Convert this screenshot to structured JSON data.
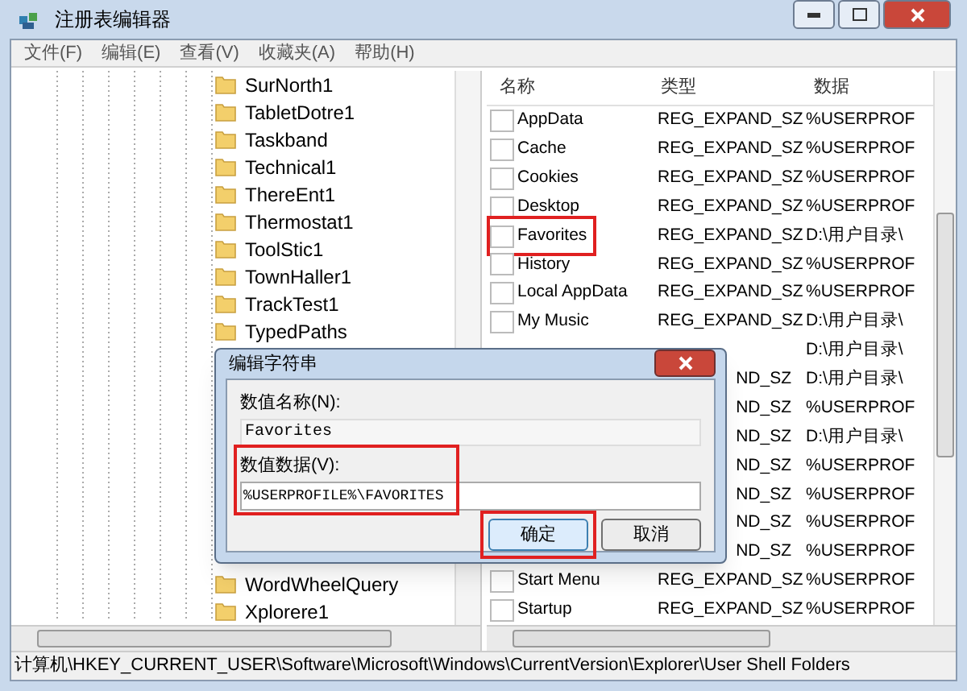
{
  "window": {
    "title": "注册表编辑器"
  },
  "menu": [
    "文件(F)",
    "编辑(E)",
    "查看(V)",
    "收藏夹(A)",
    "帮助(H)"
  ],
  "tree": {
    "items_top": [
      {
        "label": "SurNorth1"
      },
      {
        "label": "TabletDotre1"
      },
      {
        "label": "Taskband"
      },
      {
        "label": "Technical1"
      },
      {
        "label": "ThereEnt1"
      },
      {
        "label": "Thermostat1"
      },
      {
        "label": "ToolStic1"
      },
      {
        "label": "TownHaller1"
      },
      {
        "label": "TrackTest1"
      },
      {
        "label": "TypedPaths"
      }
    ],
    "items_bottom": [
      {
        "label": "WordWheelQuery"
      },
      {
        "label": "Xplorere1"
      }
    ]
  },
  "table": {
    "columns": [
      "名称",
      "类型",
      "数据"
    ],
    "rows": [
      {
        "kind": "full",
        "name": "AppData",
        "type": "REG_EXPAND_SZ",
        "data": "%USERPROF",
        "highlighted": false
      },
      {
        "kind": "full",
        "name": "Cache",
        "type": "REG_EXPAND_SZ",
        "data": "%USERPROF",
        "highlighted": false
      },
      {
        "kind": "full",
        "name": "Cookies",
        "type": "REG_EXPAND_SZ",
        "data": "%USERPROF",
        "highlighted": false
      },
      {
        "kind": "full",
        "name": "Desktop",
        "type": "REG_EXPAND_SZ",
        "data": "%USERPROF",
        "highlighted": false
      },
      {
        "kind": "full",
        "name": "Favorites",
        "type": "REG_EXPAND_SZ",
        "data": "D:\\用户目录\\",
        "highlighted": true
      },
      {
        "kind": "full",
        "name": "History",
        "type": "REG_EXPAND_SZ",
        "data": "%USERPROF",
        "highlighted": false
      },
      {
        "kind": "full",
        "name": "Local AppData",
        "type": "REG_EXPAND_SZ",
        "data": "%USERPROF",
        "highlighted": false
      },
      {
        "kind": "full",
        "name": "My Music",
        "type": "REG_EXPAND_SZ",
        "data": "D:\\用户目录\\",
        "highlighted": false
      },
      {
        "kind": "covered",
        "data": "D:\\用户目录\\"
      },
      {
        "kind": "covered",
        "type": "ND_SZ",
        "data": "D:\\用户目录\\"
      },
      {
        "kind": "covered",
        "type": "ND_SZ",
        "data": "%USERPROF"
      },
      {
        "kind": "covered",
        "type": "ND_SZ",
        "data": "D:\\用户目录\\"
      },
      {
        "kind": "covered",
        "type": "ND_SZ",
        "data": "%USERPROF"
      },
      {
        "kind": "covered",
        "type": "ND_SZ",
        "data": "%USERPROF"
      },
      {
        "kind": "covered",
        "type": "ND_SZ",
        "data": "%USERPROF"
      },
      {
        "kind": "covered",
        "type": "ND_SZ",
        "data": "%USERPROF"
      },
      {
        "kind": "full",
        "name": "Start Menu",
        "type": "REG_EXPAND_SZ",
        "data": "%USERPROF",
        "highlighted": false
      },
      {
        "kind": "full",
        "name": "Startup",
        "type": "REG_EXPAND_SZ",
        "data": "%USERPROF",
        "highlighted": false
      }
    ]
  },
  "dialog": {
    "title": "编辑字符串",
    "name_label": "数值名称(N):",
    "name_value": "Favorites",
    "data_label": "数值数据(V):",
    "data_value": "%USERPROFILE%\\FAVORITES",
    "data_highlighted": true,
    "buttons": [
      {
        "label": "确定",
        "default": true,
        "highlighted": true
      },
      {
        "label": "取消",
        "default": false,
        "highlighted": false
      }
    ]
  },
  "status_bar": "计算机\\HKEY_CURRENT_USER\\Software\\Microsoft\\Windows\\CurrentVersion\\Explorer\\User Shell Folders"
}
